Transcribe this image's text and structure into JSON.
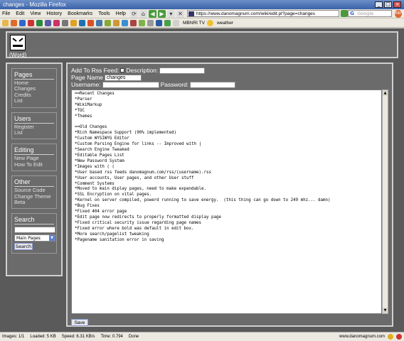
{
  "window": {
    "title": "changes - Mozilla Firefox"
  },
  "menu": [
    "File",
    "Edit",
    "View",
    "History",
    "Bookmarks",
    "Tools",
    "Help"
  ],
  "url": "https://www.danomagnum.com/wiki/edit.pl?page=changes",
  "search_placeholder": "Google",
  "bookmarks": {
    "labels": [
      "MBNRI TV",
      "weather"
    ]
  },
  "logo": {
    "label": "(Word)"
  },
  "sidebar": {
    "pages": {
      "title": "Pages",
      "links": [
        "Home",
        "Changes",
        "Credits",
        "List"
      ]
    },
    "users": {
      "title": "Users",
      "links": [
        "Register",
        "List"
      ]
    },
    "editing": {
      "title": "Editing",
      "links": [
        "New Page",
        "How To Edit"
      ]
    },
    "other": {
      "title": "Other",
      "links": [
        "Source Code",
        "Change Theme",
        "Beta"
      ]
    },
    "search": {
      "title": "Search",
      "select_value": "Main Pages",
      "button": "Search"
    }
  },
  "form": {
    "rss_label": "Add To Rss Feed:",
    "description_label": "Description:",
    "page_name_label": "Page Name",
    "page_name_value": "changes",
    "username_label": "Username:",
    "password_label": "Password:",
    "save_label": "Save"
  },
  "editor_text": "==Recent Changes\n*Parser\n*WikiMarkup\n*TOC\n*Themes\n\n==Old Changes\n*Rich Namespace Support (90% implemented)\n*Custom WYSIWYG Editor\n*Custom Parsing Engine for links -- Improved with |\n*Search Engine Tweaked\n*Editable Pages List\n*New Password System\n*Images with ( (\n*User based rss feeds danomagnum.com/rss/(username).rss\n*User accounts, User pages, and other User stuff\n*Comment Systems\n*Moved to main diplay pages, need to make expandable.\n*SSL Encryption on vital pages.\n*Kernel on server compiled, powerd running to save energy.  (this thing can go down to 249 mhz... damn)\n*Bug Fixes\n*Fixed 404 error page\n*Edit page now redirects to properly formatted display page\n*Fixed critical security issue regarding page names\n*Fixed error where bold was default in edit box.\n*More search/pagelist tweaking\n*Pagename sanitation error in saving",
  "status": {
    "images": "Images: 1/1",
    "loaded": "Loaded: 5 KB",
    "speed": "Speed: 6.31 KB/s",
    "time": "Time: 0.794",
    "done": "Done",
    "domain": "www.danomagnum.com"
  },
  "colors": {
    "page_bg": "#5a5a5a",
    "panel_bg": "#6b6b6b",
    "border": "#cfcfcf"
  }
}
